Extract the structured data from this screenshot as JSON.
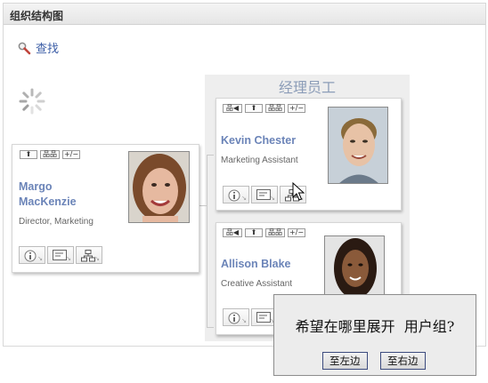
{
  "panel": {
    "title": "组织结构图"
  },
  "search": {
    "label": "查找",
    "icon": "magnifier-icon"
  },
  "group": {
    "title": "经理员工"
  },
  "nav_labels": {
    "up": "⬆",
    "tree": "品品",
    "toggle": "+/−",
    "back": "品◀"
  },
  "manager": {
    "name_line1": "Margo",
    "name_line2": "MacKenzie",
    "title": "Director, Marketing"
  },
  "employees": [
    {
      "name": "Kevin Chester",
      "title": "Marketing Assistant"
    },
    {
      "name": "Allison Blake",
      "title": "Creative Assistant"
    }
  ],
  "popup": {
    "question": "希望在哪里展开  用户组?",
    "left_button": "至左边",
    "right_button": "至右边"
  },
  "colors": {
    "name": "#6b84b8",
    "group_title": "#8c9db8",
    "link": "#3b5da6"
  }
}
